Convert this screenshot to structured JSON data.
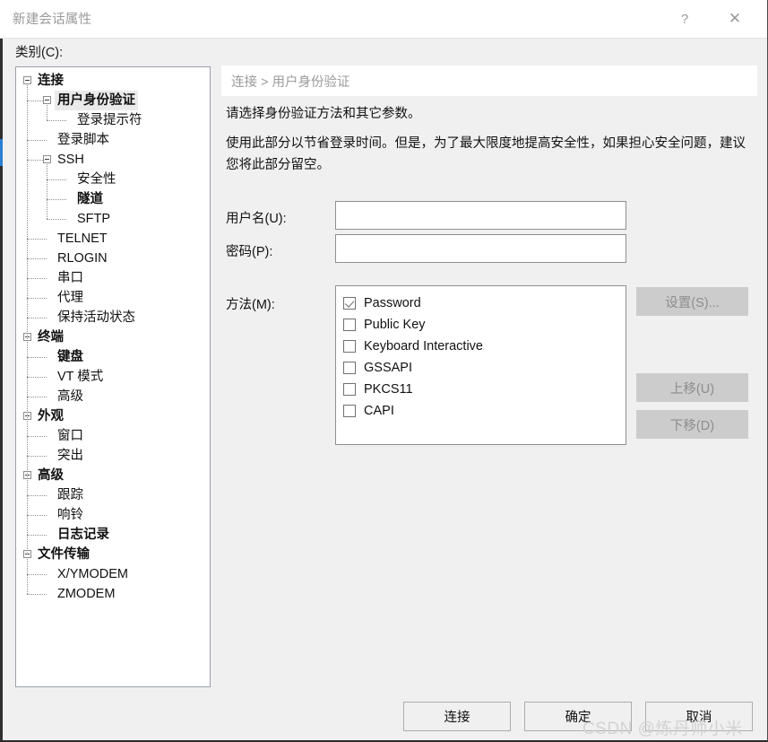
{
  "window": {
    "title": "新建会话属性",
    "help_icon": "?",
    "close_icon": "✕"
  },
  "category": {
    "label": "类别(C):",
    "tree": [
      {
        "label": "连接",
        "depth": 0,
        "bold": true,
        "expander": true,
        "selected": false
      },
      {
        "label": "用户身份验证",
        "depth": 1,
        "bold": true,
        "expander": true,
        "selected": true
      },
      {
        "label": "登录提示符",
        "depth": 2,
        "bold": false,
        "expander": false,
        "selected": false
      },
      {
        "label": "登录脚本",
        "depth": 1,
        "bold": false,
        "expander": false,
        "selected": false
      },
      {
        "label": "SSH",
        "depth": 1,
        "bold": false,
        "expander": true,
        "selected": false
      },
      {
        "label": "安全性",
        "depth": 2,
        "bold": false,
        "expander": false,
        "selected": false
      },
      {
        "label": "隧道",
        "depth": 2,
        "bold": true,
        "expander": false,
        "selected": false
      },
      {
        "label": "SFTP",
        "depth": 2,
        "bold": false,
        "expander": false,
        "selected": false
      },
      {
        "label": "TELNET",
        "depth": 1,
        "bold": false,
        "expander": false,
        "selected": false
      },
      {
        "label": "RLOGIN",
        "depth": 1,
        "bold": false,
        "expander": false,
        "selected": false
      },
      {
        "label": "串口",
        "depth": 1,
        "bold": false,
        "expander": false,
        "selected": false
      },
      {
        "label": "代理",
        "depth": 1,
        "bold": false,
        "expander": false,
        "selected": false
      },
      {
        "label": "保持活动状态",
        "depth": 1,
        "bold": false,
        "expander": false,
        "selected": false
      },
      {
        "label": "终端",
        "depth": 0,
        "bold": true,
        "expander": true,
        "selected": false
      },
      {
        "label": "键盘",
        "depth": 1,
        "bold": true,
        "expander": false,
        "selected": false
      },
      {
        "label": "VT 模式",
        "depth": 1,
        "bold": false,
        "expander": false,
        "selected": false
      },
      {
        "label": "高级",
        "depth": 1,
        "bold": false,
        "expander": false,
        "selected": false
      },
      {
        "label": "外观",
        "depth": 0,
        "bold": true,
        "expander": true,
        "selected": false
      },
      {
        "label": "窗口",
        "depth": 1,
        "bold": false,
        "expander": false,
        "selected": false
      },
      {
        "label": "突出",
        "depth": 1,
        "bold": false,
        "expander": false,
        "selected": false
      },
      {
        "label": "高级",
        "depth": 0,
        "bold": true,
        "expander": true,
        "selected": false
      },
      {
        "label": "跟踪",
        "depth": 1,
        "bold": false,
        "expander": false,
        "selected": false
      },
      {
        "label": "响铃",
        "depth": 1,
        "bold": false,
        "expander": false,
        "selected": false
      },
      {
        "label": "日志记录",
        "depth": 1,
        "bold": true,
        "expander": false,
        "selected": false
      },
      {
        "label": "文件传输",
        "depth": 0,
        "bold": true,
        "expander": true,
        "selected": false
      },
      {
        "label": "X/YMODEM",
        "depth": 1,
        "bold": false,
        "expander": false,
        "selected": false
      },
      {
        "label": "ZMODEM",
        "depth": 1,
        "bold": false,
        "expander": false,
        "selected": false
      }
    ]
  },
  "content": {
    "breadcrumb": "连接 > 用户身份验证",
    "description_line1": "请选择身份验证方法和其它参数。",
    "description_line2": "使用此部分以节省登录时间。但是，为了最大限度地提高安全性，如果担心安全问题，建议您将此部分留空。",
    "username": {
      "label": "用户名(U):",
      "value": "",
      "placeholder": ""
    },
    "password": {
      "label": "密码(P):",
      "value": "",
      "placeholder": ""
    },
    "methods": {
      "label": "方法(M):",
      "items": [
        {
          "label": "Password",
          "checked": true
        },
        {
          "label": "Public Key",
          "checked": false
        },
        {
          "label": "Keyboard Interactive",
          "checked": false
        },
        {
          "label": "GSSAPI",
          "checked": false
        },
        {
          "label": "PKCS11",
          "checked": false
        },
        {
          "label": "CAPI",
          "checked": false
        }
      ]
    },
    "side_buttons": {
      "settings": "设置(S)...",
      "move_up": "上移(U)",
      "move_down": "下移(D)"
    }
  },
  "footer": {
    "connect": "连接",
    "ok": "确定",
    "cancel": "取消"
  },
  "watermark": "CSDN @炼丹师小米",
  "colors": {
    "dialog_bg": "#f0f0f0",
    "accent": "#2a7fd4",
    "disabled_btn": "#cccccc",
    "title_text": "#9a9a9a"
  }
}
